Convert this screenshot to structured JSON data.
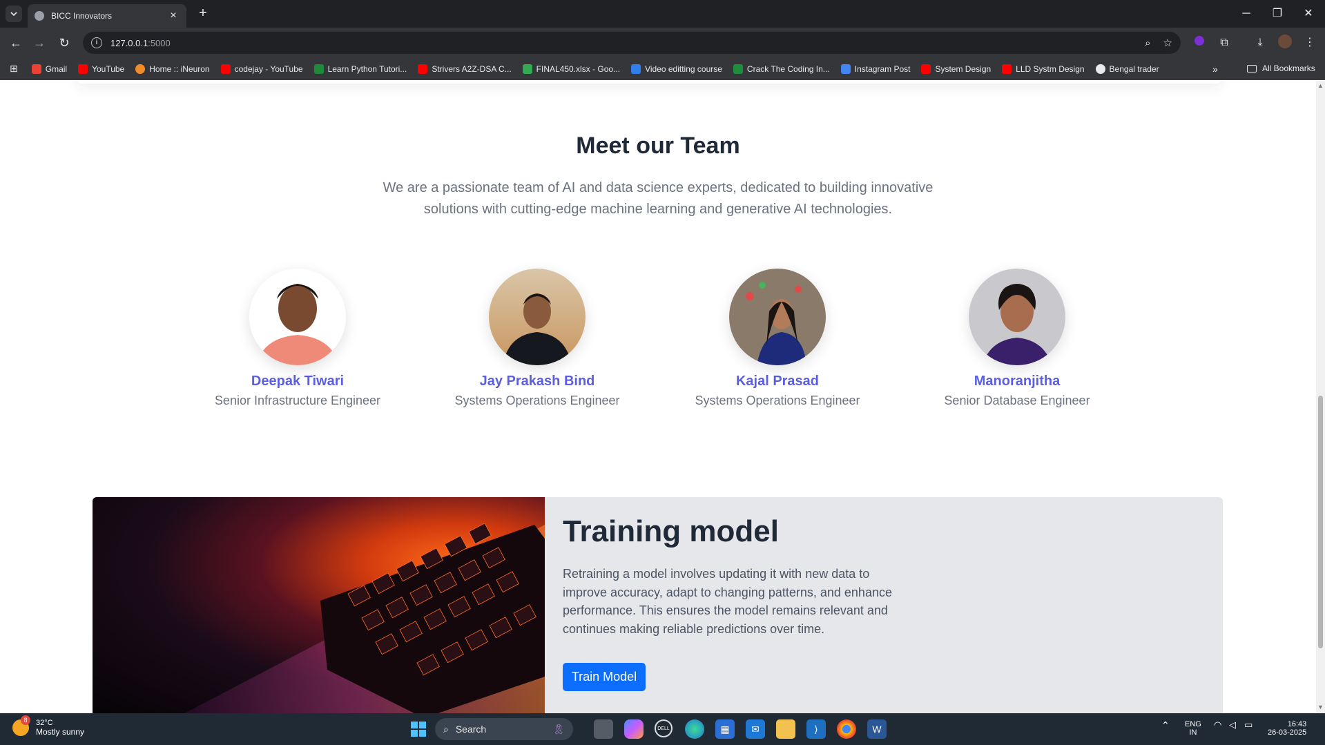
{
  "browser": {
    "tab_title": "BICC Innovators",
    "url_host": "127.0.0.1",
    "url_port": ":5000",
    "bookmarks": [
      {
        "label": "Gmail",
        "color": "#ea4335"
      },
      {
        "label": "YouTube",
        "color": "#ff0000"
      },
      {
        "label": "Home :: iNeuron",
        "color": "#f28c28"
      },
      {
        "label": "codejay - YouTube",
        "color": "#ff0000"
      },
      {
        "label": "Learn Python Tutori...",
        "color": "#1f8a3a"
      },
      {
        "label": "Strivers A2Z-DSA C...",
        "color": "#ff0000"
      },
      {
        "label": "FINAL450.xlsx - Goo...",
        "color": "#34a853"
      },
      {
        "label": "Video editting course",
        "color": "#2f80ed"
      },
      {
        "label": "Crack The Coding In...",
        "color": "#1e8e3e"
      },
      {
        "label": "Instagram Post",
        "color": "#4285f4"
      },
      {
        "label": "System Design",
        "color": "#ff0000"
      },
      {
        "label": "LLD Systm Design",
        "color": "#ff0000"
      },
      {
        "label": "Bengal trader",
        "color": "#e8eaed"
      }
    ],
    "all_bookmarks": "All Bookmarks"
  },
  "team": {
    "title": "Meet our Team",
    "description": "We are a passionate team of AI and data science experts, dedicated to building innovative solutions with cutting-edge machine learning and generative AI technologies.",
    "members": [
      {
        "name": "Deepak Tiwari",
        "role": "Senior Infrastructure Engineer"
      },
      {
        "name": "Jay Prakash Bind",
        "role": "Systems Operations Engineer"
      },
      {
        "name": "Kajal Prasad",
        "role": "Systems Operations Engineer"
      },
      {
        "name": "Manoranjitha",
        "role": "Senior Database Engineer"
      }
    ]
  },
  "training": {
    "title": "Training model",
    "description": "Retraining a model involves updating it with new data to improve accuracy, adapt to changing patterns, and enhance performance. This ensures the model remains relevant and continues making reliable predictions over time.",
    "button_label": "Train Model"
  },
  "taskbar": {
    "temperature": "32°C",
    "weather": "Mostly sunny",
    "weather_badge": "8",
    "search_placeholder": "Search",
    "lang": "ENG",
    "region": "IN",
    "time": "16:43",
    "date": "26-03-2025"
  },
  "colors": {
    "accent_name": "#5b5fe0",
    "button_blue": "#0d6efd",
    "card_bg": "#e5e7eb"
  }
}
